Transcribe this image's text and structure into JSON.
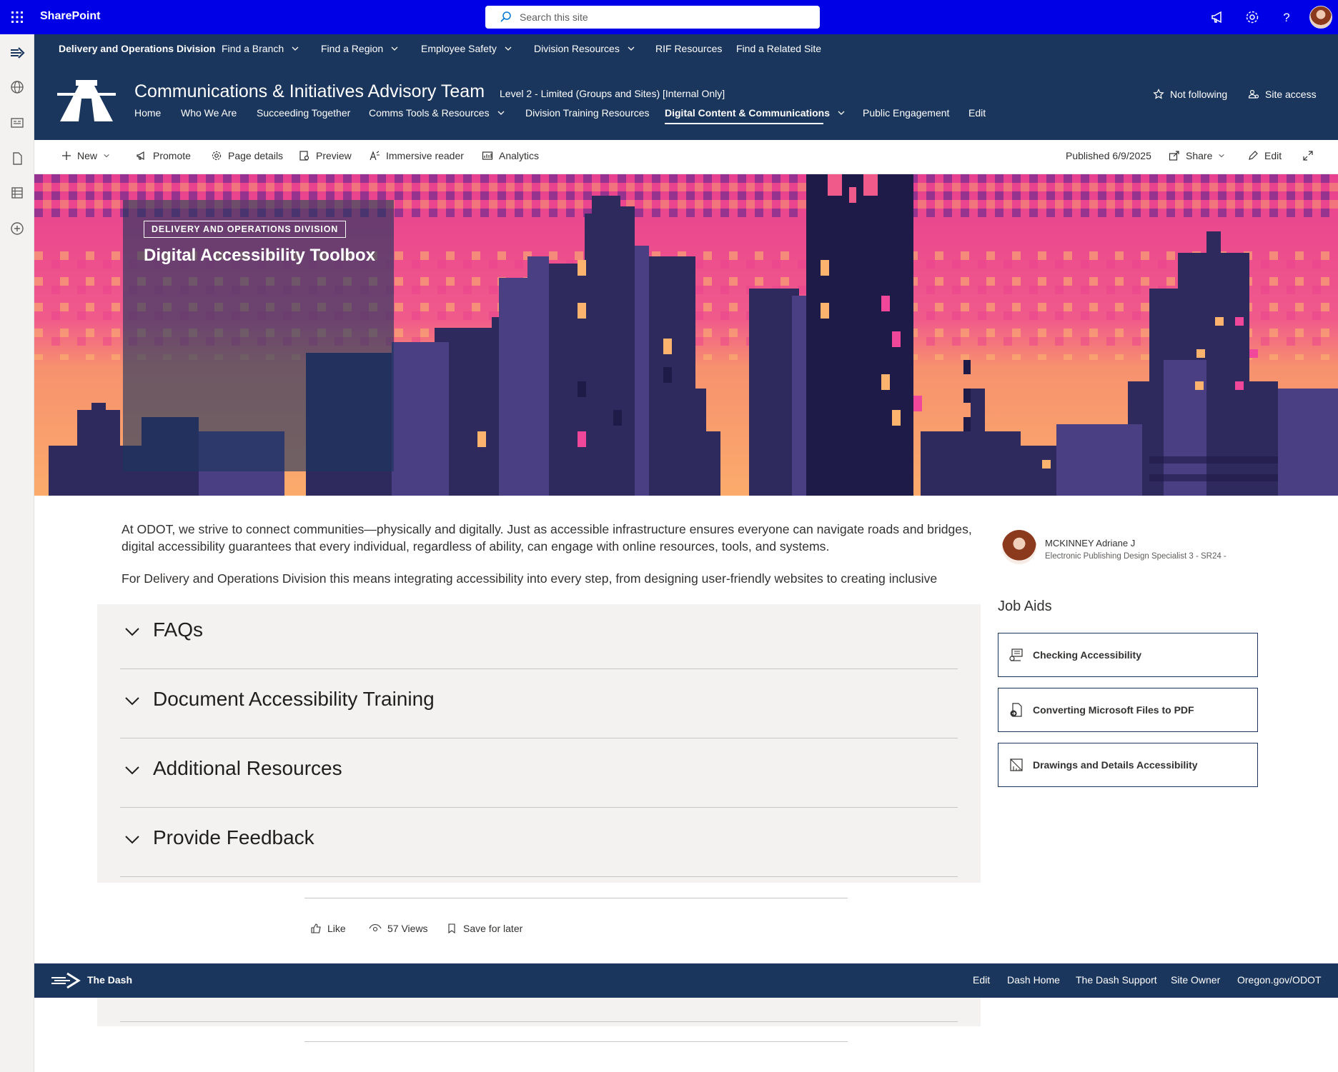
{
  "suite": {
    "brand": "SharePoint",
    "search_placeholder": "Search this site"
  },
  "hub_nav": {
    "title": "Delivery and Operations Division",
    "items": [
      {
        "label": "Find a Branch",
        "dropdown": true
      },
      {
        "label": "Find a Region",
        "dropdown": true
      },
      {
        "label": "Employee Safety",
        "dropdown": true
      },
      {
        "label": "Division Resources",
        "dropdown": true
      },
      {
        "label": "RIF Resources",
        "dropdown": false
      },
      {
        "label": "Find a Related Site",
        "dropdown": false
      }
    ]
  },
  "site": {
    "title": "Communications & Initiatives Advisory Team",
    "classification": "Level 2 - Limited (Groups and Sites) [Internal Only]",
    "nav": [
      {
        "label": "Home"
      },
      {
        "label": "Who We Are"
      },
      {
        "label": "Succeeding Together"
      },
      {
        "label": "Comms Tools & Resources",
        "dropdown": true
      },
      {
        "label": "Division Training Resources"
      },
      {
        "label": "Digital Content & Communications",
        "dropdown": true,
        "active": true
      },
      {
        "label": "Public Engagement"
      },
      {
        "label": "Edit"
      }
    ],
    "follow_label": "Not following",
    "site_access_label": "Site access"
  },
  "command_bar": {
    "new": "New",
    "promote": "Promote",
    "page_details": "Page details",
    "preview": "Preview",
    "immersive_reader": "Immersive reader",
    "analytics": "Analytics",
    "published": "Published 6/9/2025",
    "share": "Share",
    "edit": "Edit"
  },
  "hero": {
    "topic": "DELIVERY AND OPERATIONS DIVISION",
    "title": "Digital Accessibility Toolbox"
  },
  "body": {
    "paragraph1": "At ODOT, we strive to connect communities—physically and digitally. Just as accessible infrastructure ensures everyone can navigate roads and bridges, digital accessibility guarantees that every individual, regardless of ability, can engage with online resources, tools, and systems.",
    "paragraph2": "For Delivery and Operations Division this means integrating accessibility into every step, from designing user-friendly websites to creating inclusive"
  },
  "accordion": [
    {
      "label": "FAQs"
    },
    {
      "label": "Document Accessibility Training"
    },
    {
      "label": "Additional Resources"
    },
    {
      "label": "Provide Feedback"
    }
  ],
  "author": {
    "name": "MCKINNEY Adriane J",
    "role": "Electronic Publishing Design Specialist 3 - SR24 -"
  },
  "job_aids": {
    "title": "Job Aids",
    "items": [
      {
        "label": "Checking Accessibility",
        "icon": "accessibility-checker-icon"
      },
      {
        "label": "Converting Microsoft Files to PDF",
        "icon": "document-convert-icon"
      },
      {
        "label": "Drawings and Details Accessibility",
        "icon": "drawing-ruler-icon"
      }
    ]
  },
  "social": {
    "like": "Like",
    "views": "57 Views",
    "save": "Save for later"
  },
  "footer": {
    "brand": "The Dash",
    "links": [
      "Edit",
      "Dash Home",
      "The Dash Support",
      "Site Owner",
      "Oregon.gov/ODOT"
    ]
  },
  "colors": {
    "suite_bar": "#0000e6",
    "theme_navy": "#1b365d",
    "accordion_bg": "#f3f2f1"
  }
}
